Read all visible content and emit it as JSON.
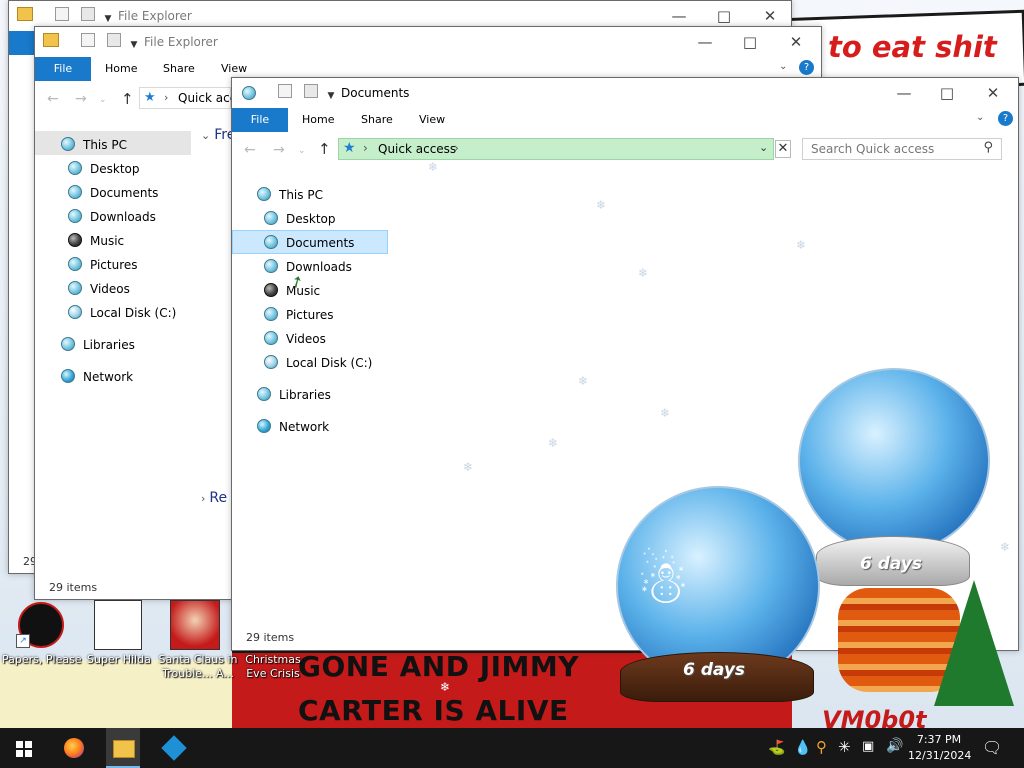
{
  "desktop": {
    "banner_top_text": "to eat shit",
    "banner_bottom_line1": "GONE AND JIMMY",
    "banner_bottom_line2": "CARTER IS ALIVE",
    "banner_watermark": "VM0b0t",
    "icons": [
      {
        "label": "Papers, Please"
      },
      {
        "label": "Super Hilda"
      },
      {
        "label": "Santa Claus in Trouble... A..."
      },
      {
        "label": "Christmas Eve Crisis"
      }
    ],
    "globes": [
      {
        "label": "6 days"
      },
      {
        "label": "6 days"
      }
    ]
  },
  "window_back": {
    "title": "File Explorer",
    "status": "29"
  },
  "window_mid": {
    "title": "File Explorer",
    "tabs": [
      "File",
      "Home",
      "Share",
      "View"
    ],
    "address": "Quick acc",
    "section_frequent": "Fre",
    "section_recent": "Re",
    "tree": [
      {
        "label": "This PC",
        "icon": "this-pc-icon"
      },
      {
        "label": "Desktop",
        "icon": "desktop-folder-icon"
      },
      {
        "label": "Documents",
        "icon": "documents-folder-icon"
      },
      {
        "label": "Downloads",
        "icon": "downloads-folder-icon"
      },
      {
        "label": "Music",
        "icon": "music-folder-icon"
      },
      {
        "label": "Pictures",
        "icon": "pictures-folder-icon"
      },
      {
        "label": "Videos",
        "icon": "videos-folder-icon"
      },
      {
        "label": "Local Disk (C:)",
        "icon": "local-disk-icon"
      },
      {
        "label": "Libraries",
        "icon": "libraries-icon"
      },
      {
        "label": "Network",
        "icon": "network-icon"
      }
    ],
    "status": "29 items"
  },
  "window_main": {
    "title": "Documents",
    "tabs": [
      "File",
      "Home",
      "Share",
      "View"
    ],
    "address": "Quick access",
    "search_placeholder": "Search Quick access",
    "tree": [
      {
        "label": "This PC",
        "icon": "this-pc-icon"
      },
      {
        "label": "Desktop",
        "icon": "desktop-folder-icon"
      },
      {
        "label": "Documents",
        "icon": "documents-folder-icon"
      },
      {
        "label": "Downloads",
        "icon": "downloads-folder-icon"
      },
      {
        "label": "Music",
        "icon": "music-folder-icon"
      },
      {
        "label": "Pictures",
        "icon": "pictures-folder-icon"
      },
      {
        "label": "Videos",
        "icon": "videos-folder-icon"
      },
      {
        "label": "Local Disk (C:)",
        "icon": "local-disk-icon"
      },
      {
        "label": "Libraries",
        "icon": "libraries-icon"
      },
      {
        "label": "Network",
        "icon": "network-icon"
      }
    ],
    "selected_item": "Documents",
    "status": "29 items"
  },
  "taskbar": {
    "time": "7:37 PM",
    "date": "12/31/2024"
  }
}
